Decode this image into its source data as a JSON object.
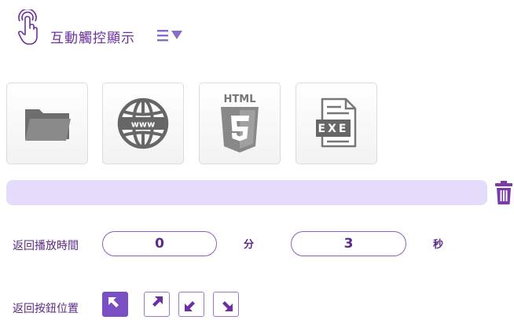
{
  "header": {
    "title": "互動觸控顯示",
    "hand_icon": "touch-hand-icon",
    "menu_icon": "list-dropdown-icon"
  },
  "media_tiles": [
    {
      "name": "folder-icon"
    },
    {
      "name": "www-globe-icon"
    },
    {
      "name": "html5-icon",
      "label": "HTML"
    },
    {
      "name": "exe-file-icon",
      "label": "EXE"
    }
  ],
  "trash_icon": "trash-icon",
  "return_play_time": {
    "label": "返回播放時間",
    "minutes": "0",
    "minutes_unit": "分",
    "seconds": "3",
    "seconds_unit": "秒"
  },
  "return_button_position": {
    "label": "返回按鈕位置",
    "selected": "top-left"
  },
  "colors": {
    "accent": "#7b4fc4",
    "bar": "#e5dbfb",
    "text": "#5b2a86"
  }
}
